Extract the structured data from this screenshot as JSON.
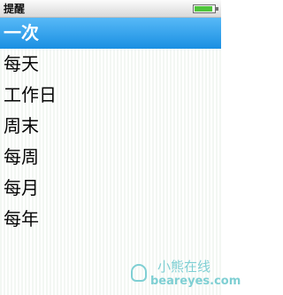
{
  "header": {
    "title": "提醒",
    "battery_level": 0.9
  },
  "menu": {
    "items": [
      {
        "label": "一次",
        "selected": true
      },
      {
        "label": "每天"
      },
      {
        "label": "工作日"
      },
      {
        "label": "周末"
      },
      {
        "label": "每周"
      },
      {
        "label": "每月"
      },
      {
        "label": "每年"
      }
    ]
  },
  "watermark": {
    "cn": "小熊在线",
    "en": "beareyes.com"
  },
  "colors": {
    "selection": "#2d9ce9",
    "battery": "#4fc53b",
    "watermark": "#7fcfd3"
  }
}
